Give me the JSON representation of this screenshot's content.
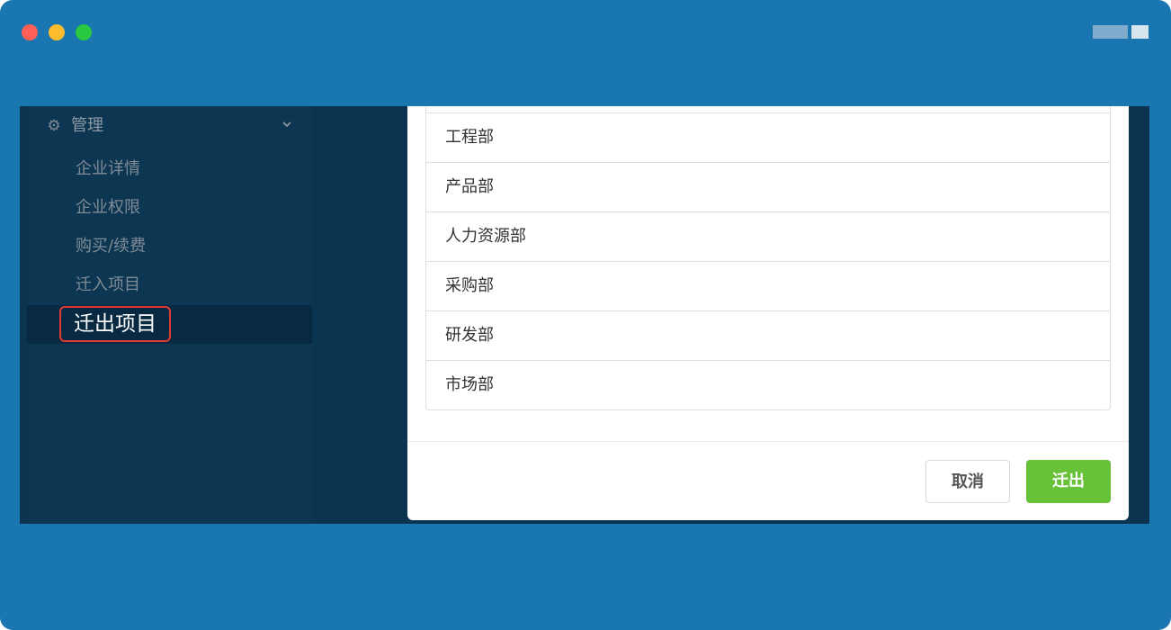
{
  "window": {
    "traffic_lights": [
      "close",
      "minimize",
      "maximize"
    ]
  },
  "sidebar": {
    "group": {
      "label": "管理",
      "icon": "gear-icon",
      "expand_icon": "chevron-down-icon"
    },
    "items": [
      {
        "label": "企业详情"
      },
      {
        "label": "企业权限"
      },
      {
        "label": "购买/续费"
      },
      {
        "label": "迁入项目"
      },
      {
        "label": "迁出项目",
        "active": true
      }
    ]
  },
  "modal": {
    "departments": [
      "工程部",
      "产品部",
      "人力资源部",
      "采购部",
      "研发部",
      "市场部"
    ],
    "cancel_label": "取消",
    "confirm_label": "迁出"
  },
  "colors": {
    "window_bg": "#1a76b0",
    "sidebar_bg": "#0d3652",
    "active_item_bg": "#072a42",
    "highlight_border": "#e53935",
    "confirm_button": "#67c23a"
  }
}
